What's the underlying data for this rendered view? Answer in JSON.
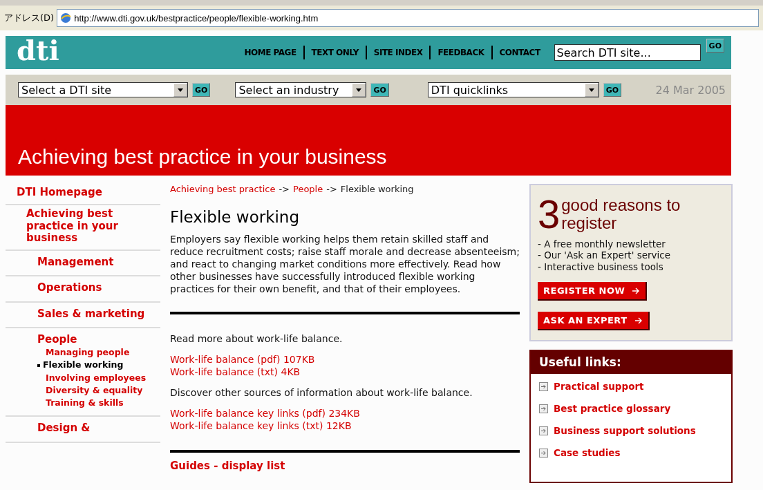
{
  "address_bar": {
    "label": "アドレス(D)",
    "url": "http://www.dti.gov.uk/bestpractice/people/flexible-working.htm"
  },
  "header": {
    "logo": "dti",
    "links": [
      "HOME PAGE",
      "TEXT ONLY",
      "SITE INDEX",
      "FEEDBACK",
      "CONTACT"
    ],
    "search": {
      "value": "Search DTI site...",
      "button": "GO"
    }
  },
  "selector_bar": {
    "selects": [
      {
        "value": "Select a DTI site",
        "button": "GO"
      },
      {
        "value": "Select an industry",
        "button": "GO"
      },
      {
        "value": "DTI quicklinks",
        "button": "GO"
      }
    ],
    "date": "24 Mar 2005"
  },
  "banner": {
    "title": "Achieving best practice in your business"
  },
  "sidebar": {
    "items": [
      {
        "label": "DTI Homepage",
        "selected": false,
        "children": [
          {
            "label": "Achieving best practice in your business",
            "selected": false,
            "children": [
              {
                "label": "Management",
                "selected": false
              },
              {
                "label": "Operations",
                "selected": false
              },
              {
                "label": "Sales & marketing",
                "selected": false
              },
              {
                "label": "People",
                "selected": false,
                "children": [
                  {
                    "label": "Managing people",
                    "selected": false
                  },
                  {
                    "label": "Flexible working",
                    "selected": true
                  },
                  {
                    "label": "Involving employees",
                    "selected": false
                  },
                  {
                    "label": "Diversity & equality",
                    "selected": false
                  },
                  {
                    "label": "Training & skills",
                    "selected": false
                  }
                ]
              },
              {
                "label": "Design &",
                "selected": false
              }
            ]
          }
        ]
      }
    ]
  },
  "breadcrumb": [
    {
      "label": "Achieving best practice",
      "link": true
    },
    {
      "label": "->",
      "link": false
    },
    {
      "label": "People",
      "link": true
    },
    {
      "label": "->",
      "link": false
    },
    {
      "label": "Flexible working",
      "link": false
    }
  ],
  "content": {
    "title": "Flexible working",
    "intro": "Employers say flexible working helps them retain skilled staff and reduce recruitment costs; raise staff morale and decrease absenteeism; and react to changing market conditions more effectively. Read how other businesses have successfully introduced flexible working practices for their own benefit, and that of their employees.",
    "sections": [
      {
        "text": "Read more about work-life balance.",
        "links": [
          "Work-life balance (pdf) 107KB",
          "Work-life balance (txt) 4KB"
        ]
      },
      {
        "text": "Discover other sources of information about work-life balance.",
        "links": [
          "Work-life balance key links (pdf) 234KB",
          "Work-life balance key links (txt) 12KB"
        ]
      }
    ],
    "next_heading": "Guides - display list"
  },
  "register_box": {
    "number": "3",
    "title": "good reasons to register",
    "reasons": [
      "- A free monthly newsletter",
      "- Our 'Ask an Expert' service",
      "- Interactive business tools"
    ],
    "buttons": [
      "REGISTER NOW",
      "ASK AN EXPERT"
    ]
  },
  "useful_links": {
    "title": "Useful links:",
    "items": [
      "Practical support",
      "Best practice glossary",
      "Business support solutions",
      "Case studies"
    ]
  }
}
